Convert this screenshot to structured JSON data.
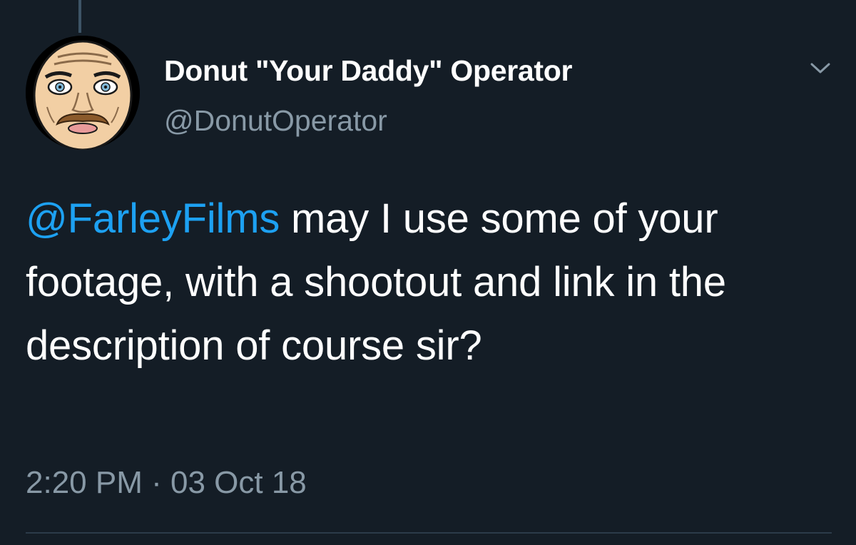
{
  "tweet": {
    "author": {
      "display_name": "Donut \"Your Daddy\" Operator",
      "handle": "@DonutOperator",
      "avatar_icon": "cartoon-face-avatar"
    },
    "menu_icon": "chevron-down-icon",
    "body": {
      "mention": "@FarleyFilms",
      "text": " may I use some of your footage, with a shootout and link in the description of course sir?"
    },
    "timestamp": {
      "time": "2:20 PM",
      "separator": " · ",
      "date": "03 Oct 18"
    }
  },
  "colors": {
    "background": "#141d26",
    "primary_text": "#ffffff",
    "secondary_text": "#8899a6",
    "link": "#1da1f2",
    "divider": "#2c3b49"
  }
}
